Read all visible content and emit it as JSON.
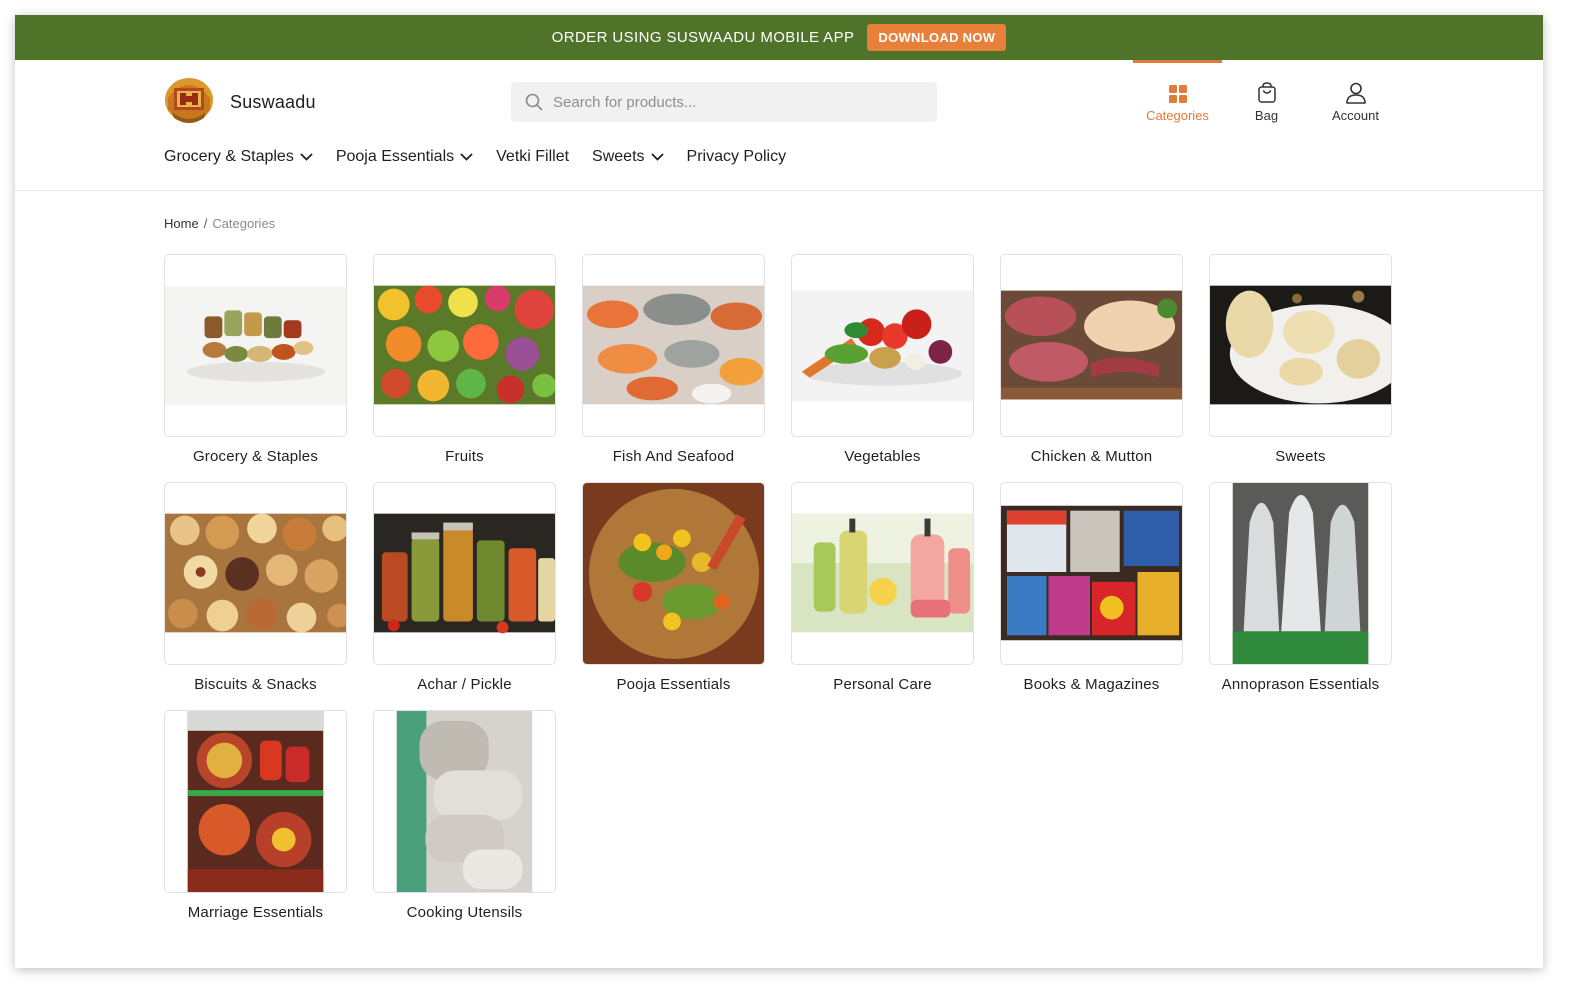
{
  "promo": {
    "text": "ORDER USING SUSWAADU MOBILE APP",
    "button_label": "DOWNLOAD NOW"
  },
  "brand": {
    "name": "Suswaadu"
  },
  "search": {
    "placeholder": "Search for products..."
  },
  "header_actions": [
    {
      "label": "Categories",
      "icon": "grid-icon",
      "active": true
    },
    {
      "label": "Bag",
      "icon": "bag-icon",
      "active": false
    },
    {
      "label": "Account",
      "icon": "user-icon",
      "active": false
    }
  ],
  "nav": [
    {
      "label": "Grocery & Staples",
      "has_dropdown": true
    },
    {
      "label": "Pooja Essentials",
      "has_dropdown": true
    },
    {
      "label": "Vetki Fillet",
      "has_dropdown": false
    },
    {
      "label": "Sweets",
      "has_dropdown": true
    },
    {
      "label": "Privacy Policy",
      "has_dropdown": false
    }
  ],
  "breadcrumb": {
    "home": "Home",
    "separator": "/",
    "current": "Categories"
  },
  "categories": [
    {
      "label": "Grocery & Staples"
    },
    {
      "label": "Fruits"
    },
    {
      "label": "Fish And Seafood"
    },
    {
      "label": "Vegetables"
    },
    {
      "label": "Chicken & Mutton"
    },
    {
      "label": "Sweets"
    },
    {
      "label": "Biscuits & Snacks"
    },
    {
      "label": "Achar / Pickle"
    },
    {
      "label": "Pooja Essentials"
    },
    {
      "label": "Personal Care"
    },
    {
      "label": "Books & Magazines"
    },
    {
      "label": "Annoprason Essentials"
    },
    {
      "label": "Marriage Essentials"
    },
    {
      "label": "Cooking Utensils"
    }
  ],
  "colors": {
    "promo_bg": "#4f7429",
    "accent": "#e07b39",
    "promo_button": "#e8803a"
  }
}
